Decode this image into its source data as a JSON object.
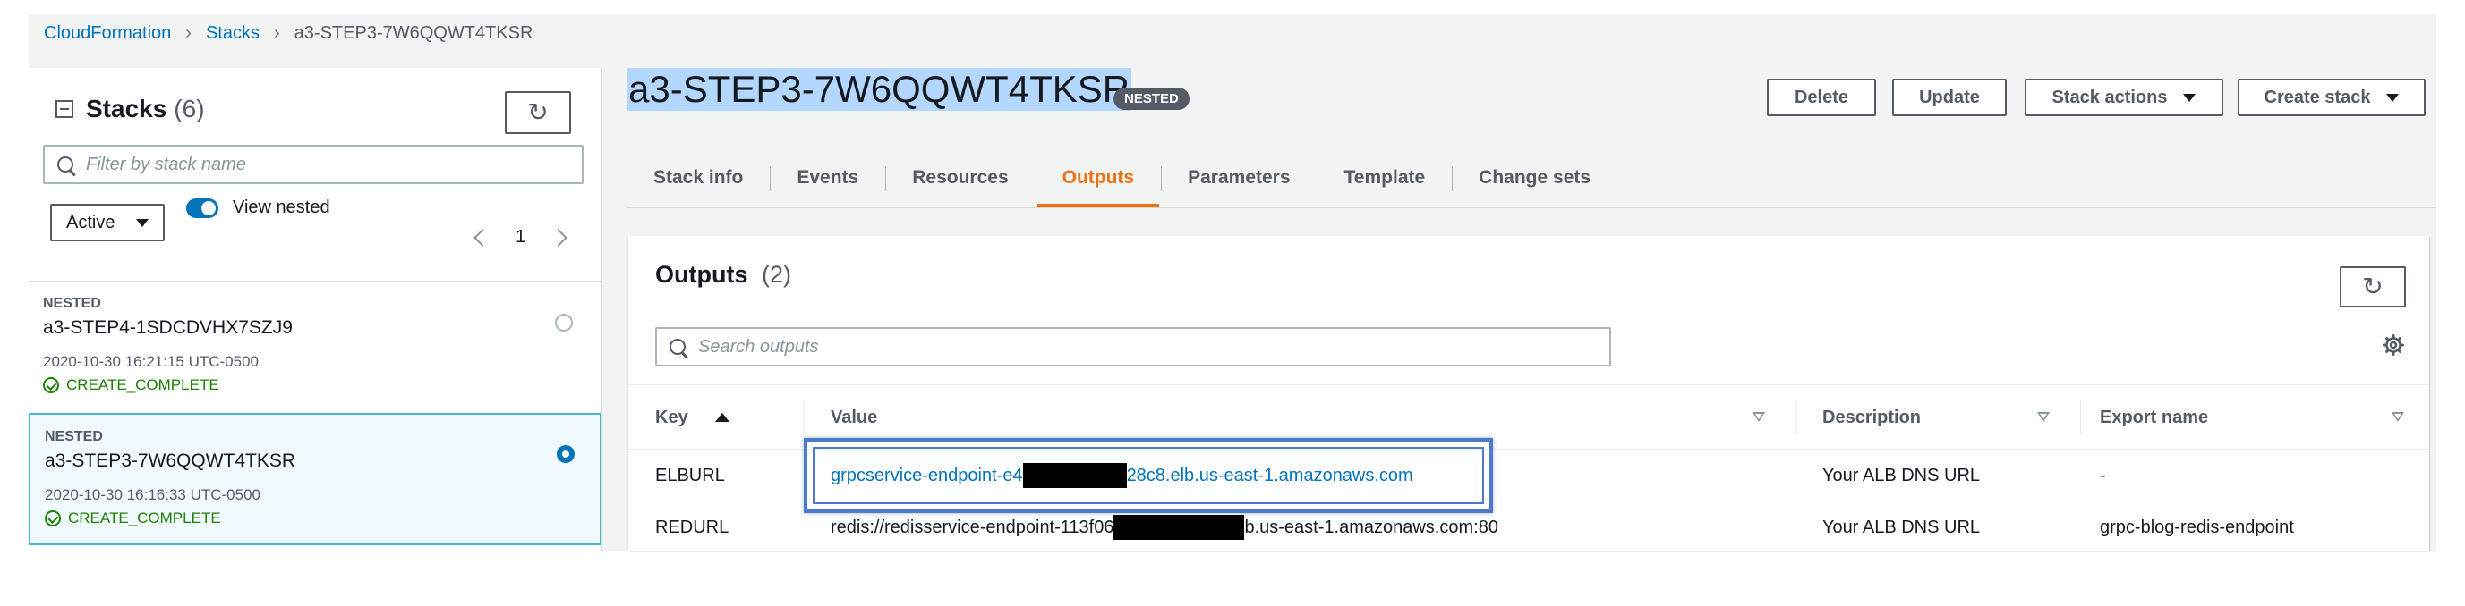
{
  "breadcrumb": {
    "root": "CloudFormation",
    "stacks": "Stacks",
    "current": "a3-STEP3-7W6QQWT4TKSR"
  },
  "left_panel": {
    "title": "Stacks",
    "count": "(6)",
    "search_placeholder": "Filter by stack name",
    "filter_value": "Active",
    "toggle_label": "View nested",
    "page_number": "1",
    "stacks": [
      {
        "badge": "NESTED",
        "name": "a3-STEP4-1SDCDVHX7SZJ9",
        "time": "2020-10-30 16:21:15 UTC-0500",
        "status": "CREATE_COMPLETE",
        "selected": false
      },
      {
        "badge": "NESTED",
        "name": "a3-STEP3-7W6QQWT4TKSR",
        "time": "2020-10-30 16:16:33 UTC-0500",
        "status": "CREATE_COMPLETE",
        "selected": true
      }
    ]
  },
  "main": {
    "title": "a3-STEP3-7W6QQWT4TKSR",
    "badge": "NESTED",
    "buttons": {
      "delete": "Delete",
      "update": "Update",
      "stack_actions": "Stack actions",
      "create_stack": "Create stack"
    },
    "tabs": [
      "Stack info",
      "Events",
      "Resources",
      "Outputs",
      "Parameters",
      "Template",
      "Change sets"
    ],
    "active_tab": "Outputs"
  },
  "outputs": {
    "title": "Outputs",
    "count": "(2)",
    "search_placeholder": "Search outputs",
    "columns": [
      "Key",
      "Value",
      "Description",
      "Export name"
    ],
    "rows": [
      {
        "key": "ELBURL",
        "value_prefix": "grpcservice-endpoint-e4",
        "value_suffix": "28c8.elb.us-east-1.amazonaws.com",
        "description": "Your ALB DNS URL",
        "export": "-"
      },
      {
        "key": "REDURL",
        "value_prefix": "redis://redisservice-endpoint-113f06",
        "value_suffix": "b.us-east-1.amazonaws.com:80",
        "description": "Your ALB DNS URL",
        "export": "grpc-blog-redis-endpoint"
      }
    ]
  },
  "colors": {
    "link": "#0073bb",
    "accent": "#ec7211",
    "success": "#1d8102",
    "highlight": "#4d7bc9"
  }
}
